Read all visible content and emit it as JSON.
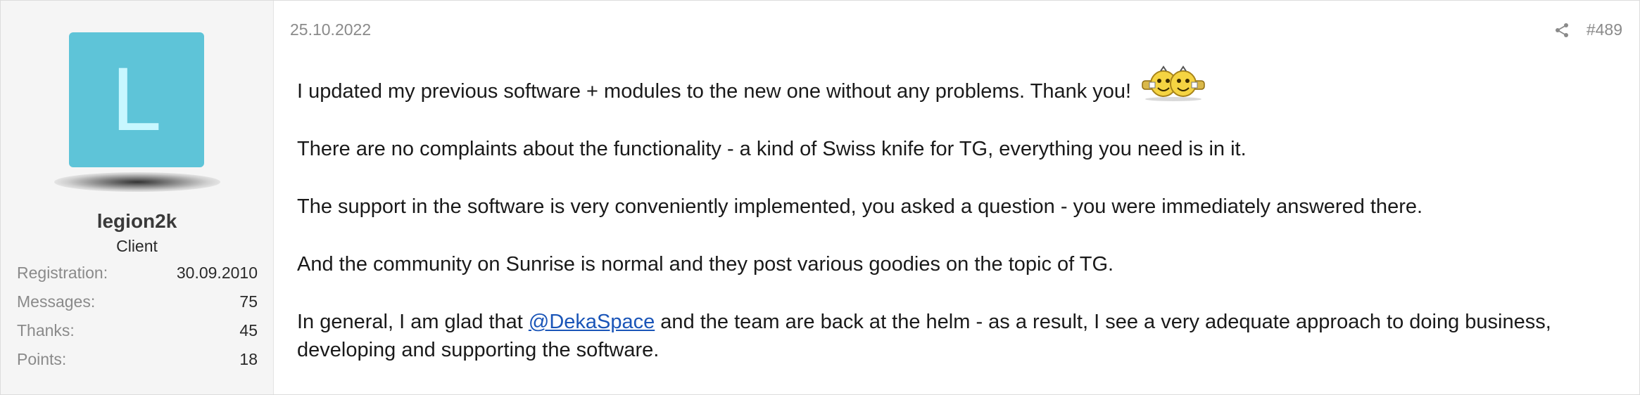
{
  "user": {
    "avatar_letter": "L",
    "avatar_color": "#5ec4d8",
    "username": "legion2k",
    "title": "Client",
    "stats": [
      {
        "label": "Registration:",
        "value": "30.09.2010"
      },
      {
        "label": "Messages:",
        "value": "75"
      },
      {
        "label": "Thanks:",
        "value": "45"
      },
      {
        "label": "Points:",
        "value": "18"
      }
    ]
  },
  "post": {
    "date": "25.10.2022",
    "number": "#489",
    "share_icon": "share-icon",
    "smiley_icon": "tg-smiley-icon",
    "paragraphs": [
      "I updated my previous software + modules to the new one without any problems. Thank you!",
      "There are no complaints about the functionality - a kind of Swiss knife for TG, everything you need is in it.",
      "The support in the software is very conveniently implemented, you asked a question - you were immediately answered there.",
      "And the community on Sunrise is normal and they post various goodies on the topic of TG."
    ],
    "last_paragraph": {
      "before": "In general, I am glad that ",
      "mention": "@DekaSpace",
      "after": " and the team are back at the helm - as a result, I see a very adequate approach to doing business, developing and supporting the software."
    },
    "mention_color": "#1a55b8"
  }
}
